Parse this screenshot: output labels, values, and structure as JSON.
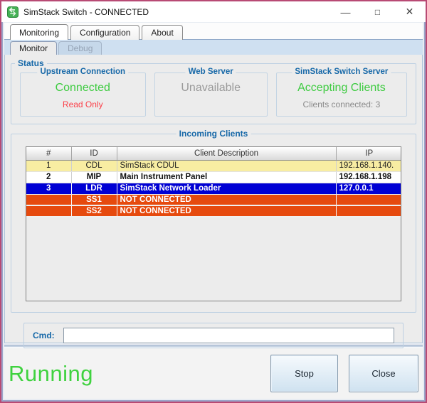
{
  "window": {
    "title": "SimStack Switch - CONNECTED",
    "minimize_glyph": "—",
    "maximize_glyph": "❐",
    "close_glyph": "✕"
  },
  "tabs": {
    "main": [
      {
        "label": "Monitoring",
        "active": true
      },
      {
        "label": "Configuration",
        "active": false
      },
      {
        "label": "About",
        "active": false
      }
    ],
    "sub": [
      {
        "label": "Monitor",
        "active": true
      },
      {
        "label": "Debug",
        "active": false,
        "disabled": true
      }
    ]
  },
  "status": {
    "group_label": "Status",
    "panels": [
      {
        "title": "Upstream Connection",
        "line1": "Connected",
        "line2": "Read Only"
      },
      {
        "title": "Web Server",
        "line1": "Unavailable",
        "line2": ""
      },
      {
        "title": "SimStack Switch Server",
        "line1": "Accepting Clients",
        "line2": "Clients connected: 3"
      }
    ]
  },
  "clients": {
    "group_label": "Incoming Clients",
    "columns": [
      "#",
      "ID",
      "Client Description",
      "IP"
    ],
    "rows": [
      {
        "num": "1",
        "id": "CDL",
        "desc": "SimStack CDUL",
        "ip": "192.168.1.140.",
        "state": "connected"
      },
      {
        "num": "2",
        "id": "MIP",
        "desc": "Main Instrument Panel",
        "ip": "192.168.1.198",
        "state": "connected"
      },
      {
        "num": "3",
        "id": "LDR",
        "desc": "SimStack Network Loader",
        "ip": "127.0.0.1",
        "state": "selected"
      },
      {
        "num": "",
        "id": "SS1",
        "desc": "NOT CONNECTED",
        "ip": "",
        "state": "not-connected"
      },
      {
        "num": "",
        "id": "SS2",
        "desc": "NOT CONNECTED",
        "ip": "",
        "state": "not-connected"
      }
    ]
  },
  "cmd": {
    "label": "Cmd:",
    "value": ""
  },
  "footer": {
    "status_text": "Running",
    "stop_label": "Stop",
    "close_label": "Close"
  },
  "colors": {
    "window_border_pink": "#b84a74",
    "label_blue": "#1668a8",
    "connected_green": "#3ecb41",
    "readonly_red": "#fb4049",
    "unavailable_gray": "#9a9a9a",
    "running_green": "#3fd23f",
    "row_yellow": "#f8eda2",
    "row_selected_blue": "#0000d4",
    "row_not_connected_orange": "#e64a0e"
  }
}
